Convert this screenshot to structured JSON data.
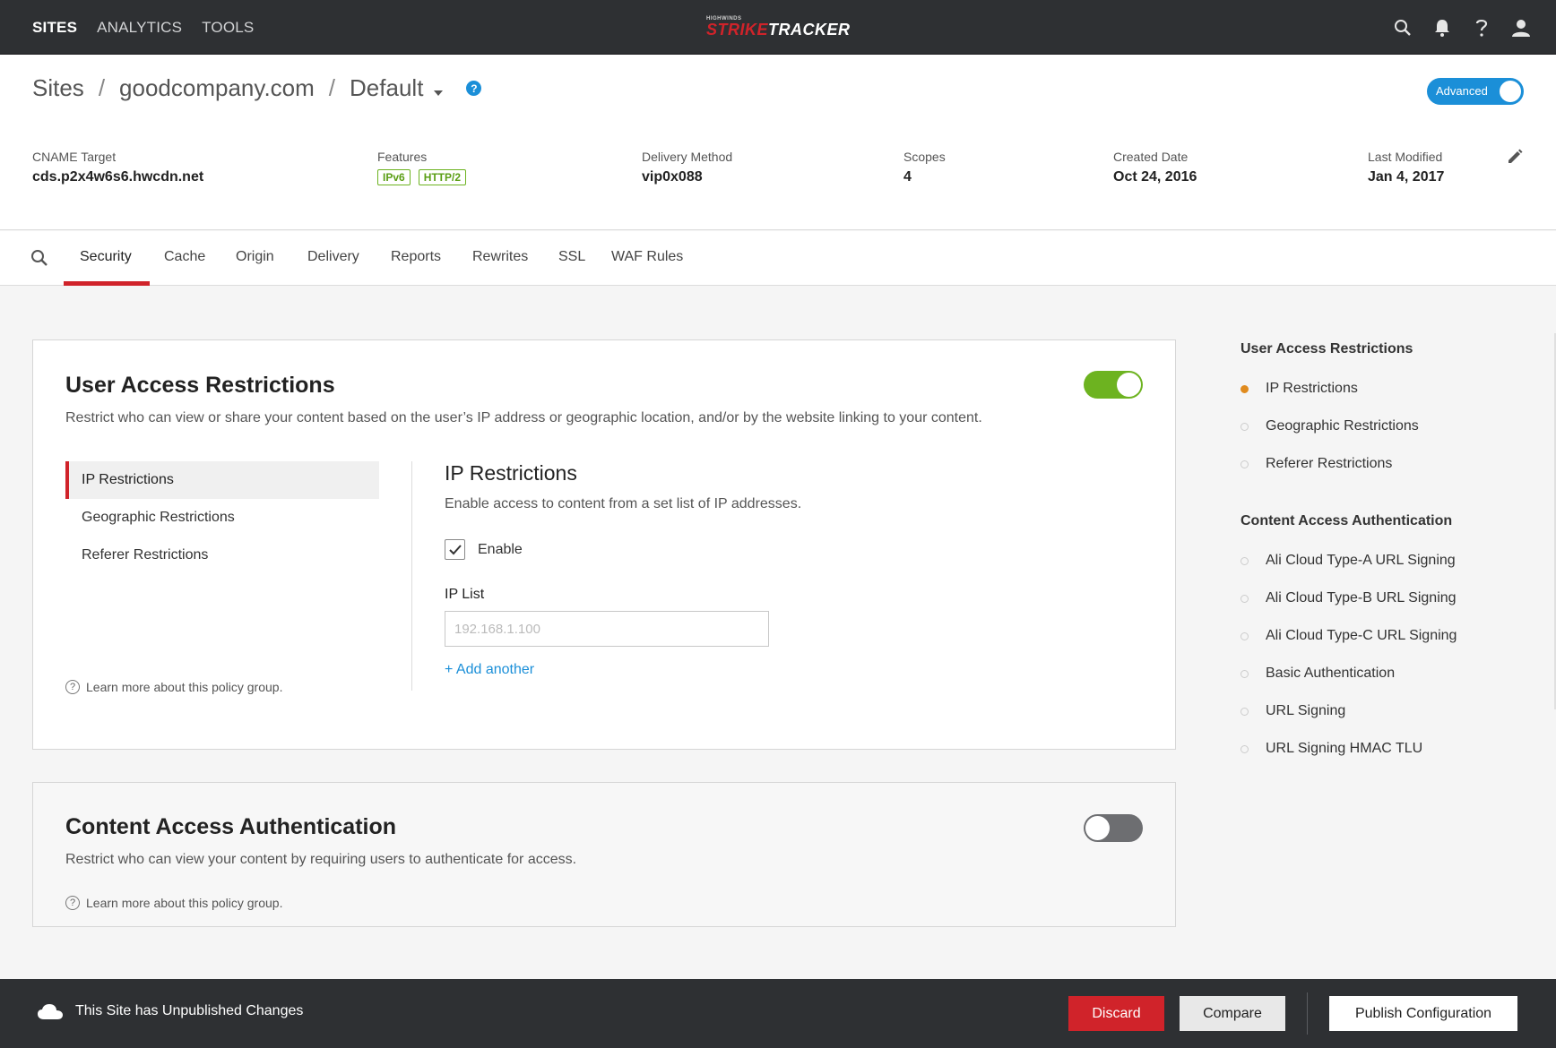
{
  "topnav": {
    "sites": "SITES",
    "analytics": "ANALYTICS",
    "tools": "TOOLS"
  },
  "logo": {
    "small": "HIGHWINDS",
    "strike": "STRIKE",
    "tracker": "TRACKER"
  },
  "breadcrumb": {
    "root": "Sites",
    "site": "goodcompany.com",
    "scope": "Default",
    "help": "?"
  },
  "advanced_toggle": {
    "label": "Advanced",
    "on": true
  },
  "meta": {
    "cname": {
      "label": "CNAME Target",
      "value": "cds.p2x4w6s6.hwcdn.net"
    },
    "features": {
      "label": "Features",
      "tags": [
        "IPv6",
        "HTTP/2"
      ]
    },
    "delivery": {
      "label": "Delivery Method",
      "value": "vip0x088"
    },
    "scopes": {
      "label": "Scopes",
      "value": "4"
    },
    "created": {
      "label": "Created Date",
      "value": "Oct 24, 2016"
    },
    "modified": {
      "label": "Last Modified",
      "value": "Jan 4, 2017"
    }
  },
  "tabs": [
    "Security",
    "Cache",
    "Origin",
    "Delivery",
    "Reports",
    "Rewrites",
    "SSL",
    "WAF Rules"
  ],
  "active_tab": "Security",
  "uar": {
    "title": "User Access Restrictions",
    "desc": "Restrict who can view or share your content based on the user’s IP address or geographic location, and/or by the website linking to your content.",
    "enabled": true,
    "subnav": [
      "IP Restrictions",
      "Geographic Restrictions",
      "Referer Restrictions"
    ],
    "panel": {
      "title": "IP Restrictions",
      "desc": "Enable access to content from a set list of IP addresses.",
      "enable_label": "Enable",
      "ip_list_label": "IP List",
      "ip_placeholder": "192.168.1.100",
      "add_another": "+ Add another"
    },
    "learn_more": "Learn more about this policy group."
  },
  "caa": {
    "title": "Content Access Authentication",
    "desc": "Restrict who can view your content by requiring users to authenticate for access.",
    "enabled": false,
    "learn_more": "Learn more about this policy group."
  },
  "outline": {
    "group1": "User Access Restrictions",
    "group1_items": [
      "IP Restrictions",
      "Geographic Restrictions",
      "Referer Restrictions"
    ],
    "group2": "Content Access Authentication",
    "group2_items": [
      "Ali Cloud Type-A URL Signing",
      "Ali Cloud Type-B URL Signing",
      "Ali Cloud Type-C URL Signing",
      "Basic Authentication",
      "URL Signing",
      "URL Signing HMAC TLU"
    ]
  },
  "footer": {
    "message": "This Site has Unpublished Changes",
    "discard": "Discard",
    "compare": "Compare",
    "publish": "Publish Configuration"
  },
  "colors": {
    "brand_red": "#d0232a",
    "accent_blue": "#1b8fd8",
    "toggle_green": "#6db320",
    "active_dot": "#e08b1e"
  }
}
